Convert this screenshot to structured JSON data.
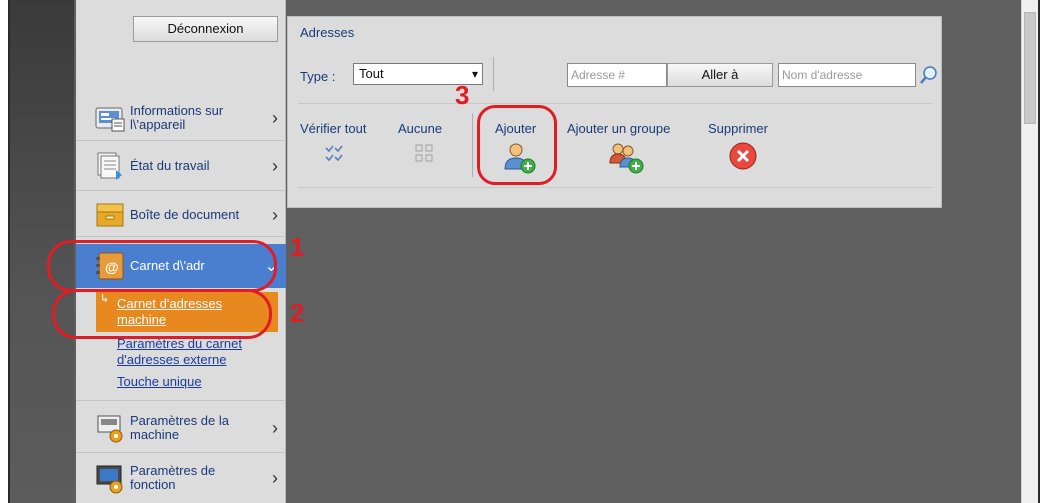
{
  "header": {
    "logout_label": "Déconnexion"
  },
  "sidebar": {
    "items": [
      {
        "label": "Informations sur l\\'appareil",
        "icon": "device-info-icon"
      },
      {
        "label": "État du travail",
        "icon": "job-status-icon"
      },
      {
        "label": "Boîte de document",
        "icon": "document-box-icon"
      },
      {
        "label": "Carnet d\\'adr",
        "icon": "address-book-icon"
      },
      {
        "label": "Paramètres de la machine",
        "icon": "machine-settings-icon"
      },
      {
        "label": "Paramètres de fonction",
        "icon": "function-settings-icon"
      }
    ],
    "sub_items": [
      {
        "label": "Carnet d'adresses machine"
      },
      {
        "label": "Paramètres du carnet d'adresses externe"
      },
      {
        "label": "Touche unique"
      }
    ]
  },
  "panel": {
    "title": "Adresses",
    "type_label": "Type :",
    "type_value": "Tout",
    "address_placeholder": "Adresse #",
    "goto_label": "Aller à",
    "name_placeholder": "Nom d'adresse",
    "actions": [
      {
        "label": "Vérifier tout",
        "icon": "check-all-icon"
      },
      {
        "label": "Aucune",
        "icon": "uncheck-all-icon"
      },
      {
        "label": "Ajouter",
        "icon": "add-user-icon"
      },
      {
        "label": "Ajouter un groupe",
        "icon": "add-group-icon"
      },
      {
        "label": "Supprimer",
        "icon": "delete-icon"
      }
    ]
  },
  "annotations": {
    "step1": "1",
    "step2": "2",
    "step3": "3"
  },
  "colors": {
    "accent_active": "#4a7fd0",
    "selected_sub": "#e8891f",
    "annotation": "#e01d24"
  }
}
